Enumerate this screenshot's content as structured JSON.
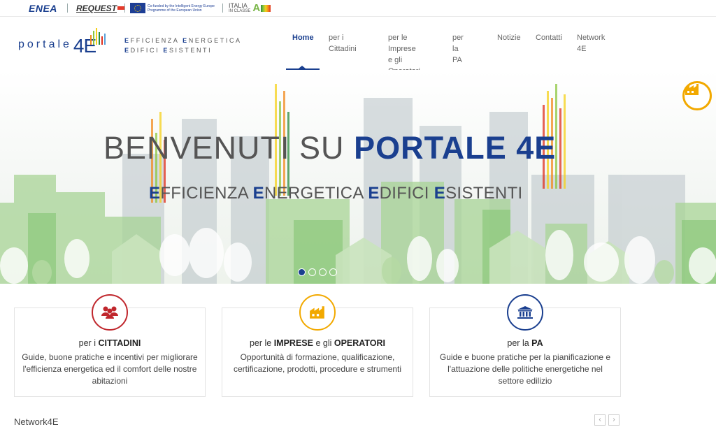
{
  "topbar": {
    "enea": "ENEA",
    "request": "REQUEST",
    "eu_text": "Co-funded by the Intelligent Energy Europe Programme of the European Union",
    "italia_line1": "ITALIA",
    "italia_line2": "IN CLASSE",
    "italia_a": "A"
  },
  "brand": {
    "name": "portale",
    "number": "4E",
    "tagline_line1_caps": [
      "E",
      "E"
    ],
    "tagline_line1": [
      "FFICIENZA",
      "NERGETICA"
    ],
    "tagline_line2_caps": [
      "E",
      "E"
    ],
    "tagline_line2": [
      "DIFICI",
      "SISTENTI"
    ]
  },
  "nav": {
    "items": [
      {
        "label": "Home",
        "active": true
      },
      {
        "label": "per i Cittadini"
      },
      {
        "label_line1": "per le Imprese",
        "label_line2": "e gli Operatori"
      },
      {
        "label": "per la PA"
      },
      {
        "label": "Notizie"
      },
      {
        "label": "Contatti"
      },
      {
        "label": "Network 4E"
      }
    ]
  },
  "hero": {
    "title_plain": "BENVENUTI SU ",
    "title_bold": "PORTALE 4E",
    "subtitle": [
      {
        "cap": "E",
        "rest": "FFICIENZA "
      },
      {
        "cap": "E",
        "rest": "NERGETICA "
      },
      {
        "cap": "E",
        "rest": "DIFICI "
      },
      {
        "cap": "E",
        "rest": "SISTENTI"
      }
    ],
    "slides": 4,
    "active_slide": 1
  },
  "cards": [
    {
      "title_prefix": "per i ",
      "title_bold": "CITTADINI",
      "title_mid": "",
      "title_bold2": "",
      "desc": "Guide, buone pratiche e incentivi per migliorare l'efficienza energetica ed il comfort delle nostre abitazioni",
      "icon": "people-icon",
      "color": "#c0272d"
    },
    {
      "title_prefix": "per le ",
      "title_bold": "IMPRESE",
      "title_mid": " e gli ",
      "title_bold2": "OPERATORI",
      "desc": "Opportunità di formazione, qualificazione, certificazione, prodotti, procedure e strumenti",
      "icon": "factory-icon",
      "color": "#f2a900"
    },
    {
      "title_prefix": "per la ",
      "title_bold": "PA",
      "title_mid": "",
      "title_bold2": "",
      "desc": "Guide e buone pratiche per la pianificazione e l'attuazione delle politiche energetiche nel settore edilizio",
      "icon": "institution-icon",
      "color": "#1a3f8f"
    }
  ],
  "network": {
    "title": "Network4E",
    "prev": "‹",
    "next": "›"
  }
}
